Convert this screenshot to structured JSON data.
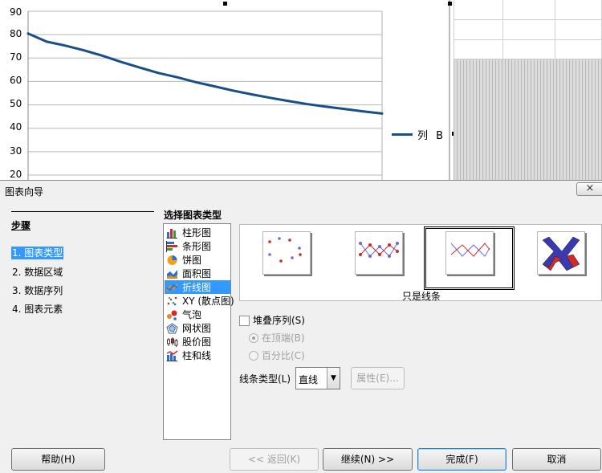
{
  "chart": {
    "y_ticks": [
      "90",
      "80",
      "70",
      "60",
      "50",
      "40",
      "30",
      "20"
    ],
    "legend_label": "列 B",
    "series_color": "#1a4f85"
  },
  "chart_data": {
    "type": "line",
    "ylim": [
      20,
      90
    ],
    "grid": true,
    "legend_position": "right",
    "series": [
      {
        "name": "列 B",
        "values": [
          80.5,
          77.0,
          75.3,
          73.3,
          71.0,
          68.3,
          65.9,
          63.6,
          61.8,
          59.7,
          57.9,
          56.1,
          54.5,
          53.0,
          51.6,
          50.3,
          49.2,
          48.2,
          47.2,
          46.3
        ]
      }
    ]
  },
  "dialog": {
    "title": "图表向导",
    "close_label": "×",
    "steps_title": "步骤",
    "steps": [
      {
        "label": "1. 图表类型"
      },
      {
        "label": "2. 数据区域"
      },
      {
        "label": "3. 数据序列"
      },
      {
        "label": "4. 图表元素"
      }
    ],
    "chart_type_title": "选择图表类型",
    "chart_types": [
      {
        "label": "柱形图",
        "icon": "column-chart-icon"
      },
      {
        "label": "条形图",
        "icon": "bar-chart-icon"
      },
      {
        "label": "饼图",
        "icon": "pie-chart-icon"
      },
      {
        "label": "面积图",
        "icon": "area-chart-icon"
      },
      {
        "label": "折线图",
        "icon": "line-chart-icon"
      },
      {
        "label": "XY (散点图)",
        "icon": "scatter-chart-icon"
      },
      {
        "label": "气泡",
        "icon": "bubble-chart-icon"
      },
      {
        "label": "网状图",
        "icon": "net-chart-icon"
      },
      {
        "label": "股价图",
        "icon": "stock-chart-icon"
      },
      {
        "label": "柱和线",
        "icon": "column-line-chart-icon"
      }
    ],
    "subtype_caption": "只是线条",
    "stack_series_label": "堆叠序列(S)",
    "on_top_label": "在顶端(B)",
    "percent_label": "百分比(C)",
    "line_type_label": "线条类型(L)",
    "line_type_value": "直线",
    "properties_label": "属性(E)...",
    "buttons": {
      "help": "帮助(H)",
      "back": "<< 返回(K)",
      "next": "继续(N) >>",
      "finish": "完成(F)",
      "cancel": "取消"
    }
  }
}
